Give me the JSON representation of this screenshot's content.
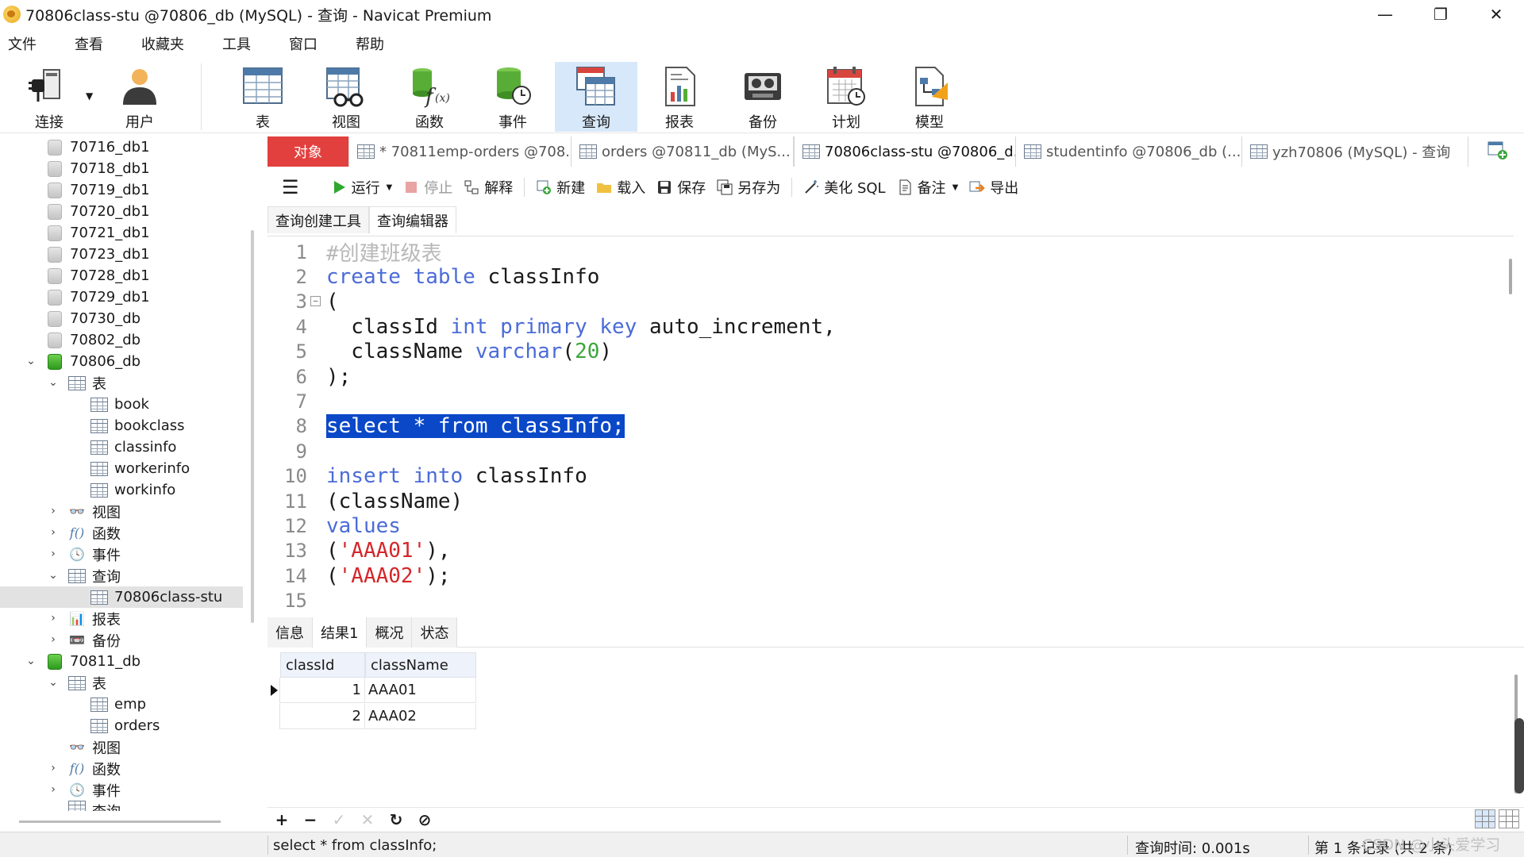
{
  "window": {
    "title": "70806class-stu @70806_db (MySQL) - 查询 - Navicat Premium",
    "minimize": "—",
    "maximize": "❐",
    "close": "✕"
  },
  "menu": [
    "文件",
    "查看",
    "收藏夹",
    "工具",
    "窗口",
    "帮助"
  ],
  "toolbar": [
    {
      "label": "连接",
      "icon": "plug-icon"
    },
    {
      "label": "用户",
      "icon": "user-icon"
    },
    {
      "label": "表",
      "icon": "table-icon"
    },
    {
      "label": "视图",
      "icon": "view-icon"
    },
    {
      "label": "函数",
      "icon": "function-icon"
    },
    {
      "label": "事件",
      "icon": "event-icon"
    },
    {
      "label": "查询",
      "icon": "query-icon",
      "active": true
    },
    {
      "label": "报表",
      "icon": "report-icon"
    },
    {
      "label": "备份",
      "icon": "backup-icon"
    },
    {
      "label": "计划",
      "icon": "schedule-icon"
    },
    {
      "label": "模型",
      "icon": "model-icon"
    }
  ],
  "sidebar": {
    "items": [
      {
        "label": "70716_db1",
        "type": "db-closed"
      },
      {
        "label": "70718_db1",
        "type": "db-closed"
      },
      {
        "label": "70719_db1",
        "type": "db-closed"
      },
      {
        "label": "70720_db1",
        "type": "db-closed"
      },
      {
        "label": "70721_db1",
        "type": "db-closed"
      },
      {
        "label": "70723_db1",
        "type": "db-closed"
      },
      {
        "label": "70728_db1",
        "type": "db-closed"
      },
      {
        "label": "70729_db1",
        "type": "db-closed"
      },
      {
        "label": "70730_db",
        "type": "db-closed"
      },
      {
        "label": "70802_db",
        "type": "db-closed"
      },
      {
        "label": "70806_db",
        "type": "db-open"
      },
      {
        "label": "表",
        "type": "tables-folder"
      },
      {
        "label": "book",
        "type": "table"
      },
      {
        "label": "bookclass",
        "type": "table"
      },
      {
        "label": "classinfo",
        "type": "table"
      },
      {
        "label": "workerinfo",
        "type": "table"
      },
      {
        "label": "workinfo",
        "type": "table"
      },
      {
        "label": "视图",
        "type": "views-folder"
      },
      {
        "label": "函数",
        "type": "functions-folder"
      },
      {
        "label": "事件",
        "type": "events-folder"
      },
      {
        "label": "查询",
        "type": "queries-folder"
      },
      {
        "label": "70806class-stu",
        "type": "query",
        "selected": true
      },
      {
        "label": "报表",
        "type": "reports-folder"
      },
      {
        "label": "备份",
        "type": "backups-folder"
      },
      {
        "label": "70811_db",
        "type": "db-open"
      },
      {
        "label": "表",
        "type": "tables-folder"
      },
      {
        "label": "emp",
        "type": "table"
      },
      {
        "label": "orders",
        "type": "table"
      },
      {
        "label": "视图",
        "type": "views-folder"
      },
      {
        "label": "函数",
        "type": "functions-folder"
      },
      {
        "label": "事件",
        "type": "events-folder"
      },
      {
        "label": "查询",
        "type": "queries-folder"
      }
    ]
  },
  "tabs": [
    {
      "label": "对象",
      "kind": "objects"
    },
    {
      "label": "* 70811emp-orders @708...",
      "kind": "query"
    },
    {
      "label": "orders @70811_db (MyS...",
      "kind": "table"
    },
    {
      "label": "70806class-stu @70806_d...",
      "kind": "query",
      "active": true
    },
    {
      "label": "studentinfo @70806_db (...",
      "kind": "table"
    },
    {
      "label": "yzh70806 (MySQL) - 查询",
      "kind": "query"
    }
  ],
  "query_toolbar": {
    "menu": "☰",
    "run": "运行",
    "stop": "停止",
    "explain": "解释",
    "new": "新建",
    "load": "载入",
    "save": "保存",
    "save_as": "另存为",
    "beautify": "美化 SQL",
    "comment": "备注",
    "export": "导出"
  },
  "editor_tabs": [
    "查询创建工具",
    "查询编辑器"
  ],
  "editor": {
    "lines": [
      {
        "n": "1",
        "parts": [
          {
            "t": "#创建班级表",
            "c": "cm"
          }
        ]
      },
      {
        "n": "2",
        "parts": [
          {
            "t": "create table",
            "c": "kw"
          },
          {
            "t": " classInfo",
            "c": ""
          }
        ]
      },
      {
        "n": "3",
        "parts": [
          {
            "t": "(",
            "c": ""
          }
        ],
        "fold": "⊟"
      },
      {
        "n": "4",
        "parts": [
          {
            "t": "  classId ",
            "c": ""
          },
          {
            "t": "int primary key",
            "c": "kw"
          },
          {
            "t": " auto_increment,",
            "c": ""
          }
        ]
      },
      {
        "n": "5",
        "parts": [
          {
            "t": "  className ",
            "c": ""
          },
          {
            "t": "varchar",
            "c": "kw"
          },
          {
            "t": "(",
            "c": ""
          },
          {
            "t": "20",
            "c": "num"
          },
          {
            "t": ")",
            "c": ""
          }
        ]
      },
      {
        "n": "6",
        "parts": [
          {
            "t": ");",
            "c": ""
          }
        ]
      },
      {
        "n": "7",
        "parts": []
      },
      {
        "n": "8",
        "parts": [
          {
            "t": "select * from classInfo;",
            "c": "sel"
          }
        ]
      },
      {
        "n": "9",
        "parts": []
      },
      {
        "n": "10",
        "parts": [
          {
            "t": "insert into",
            "c": "kw"
          },
          {
            "t": " classInfo",
            "c": ""
          }
        ]
      },
      {
        "n": "11",
        "parts": [
          {
            "t": "(className)",
            "c": ""
          }
        ]
      },
      {
        "n": "12",
        "parts": [
          {
            "t": "values",
            "c": "kw"
          }
        ]
      },
      {
        "n": "13",
        "parts": [
          {
            "t": "(",
            "c": ""
          },
          {
            "t": "'AAA01'",
            "c": "str"
          },
          {
            "t": "),",
            "c": ""
          }
        ]
      },
      {
        "n": "14",
        "parts": [
          {
            "t": "(",
            "c": ""
          },
          {
            "t": "'AAA02'",
            "c": "str"
          },
          {
            "t": ");",
            "c": ""
          }
        ]
      },
      {
        "n": "15",
        "parts": []
      }
    ]
  },
  "result_tabs": [
    "信息",
    "结果1",
    "概况",
    "状态"
  ],
  "result_grid": {
    "columns": [
      "classId",
      "className"
    ],
    "rows": [
      [
        "1",
        "AAA01"
      ],
      [
        "2",
        "AAA02"
      ]
    ]
  },
  "grid_toolbar": {
    "add": "+",
    "remove": "−",
    "apply": "✓",
    "discard": "✕",
    "refresh": "↻",
    "stop": "⊘"
  },
  "status": {
    "sql": "select * from classInfo;",
    "query_time": "查询时间: 0.001s",
    "record": "第 1 条记录 (共 2 条)"
  },
  "watermark": "CSDN @小头爱学习"
}
